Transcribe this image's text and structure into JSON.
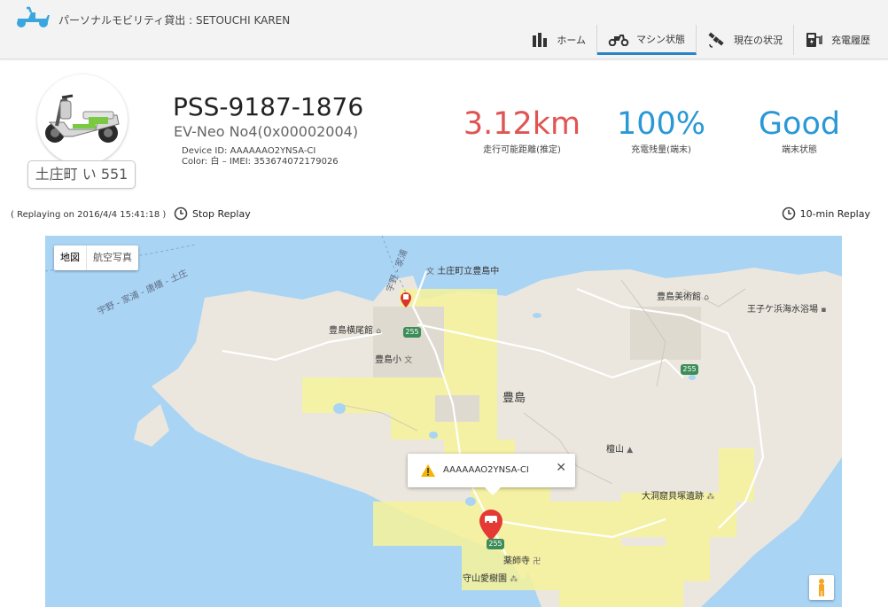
{
  "app": {
    "title": "パーソナルモビリティ貸出 : SETOUCHI KAREN"
  },
  "nav": {
    "items": [
      {
        "label": "ホーム",
        "icon": "bar-chart-icon",
        "active": false
      },
      {
        "label": "マシン状態",
        "icon": "scooter-icon",
        "active": true
      },
      {
        "label": "現在の状況",
        "icon": "satellite-icon",
        "active": false
      },
      {
        "label": "充電履歴",
        "icon": "charging-station-icon",
        "active": false
      }
    ]
  },
  "vehicle": {
    "plate": "土庄町 い 551",
    "id": "PSS-9187-1876",
    "model": "EV-Neo No4(0x00002004)",
    "device_id": "Device ID: AAAAAAO2YNSA-CI",
    "color_imei": "Color: 白 – IMEI: 353674072179026"
  },
  "metrics": {
    "range": {
      "value": "3.12km",
      "label": "走行可能距離(推定)"
    },
    "battery": {
      "value": "100%",
      "label": "充電残量(端末)"
    },
    "state": {
      "value": "Good",
      "label": "端末状態"
    }
  },
  "replay": {
    "info": "( Replaying on  2016/4/4 15:41:18 )",
    "stop_label": "Stop Replay",
    "tenmin_label": "10-min Replay"
  },
  "map": {
    "type_map": "地図",
    "type_aerial": "航空写真",
    "route_numbers": [
      "255",
      "255",
      "255"
    ],
    "road_label_1": "宇野 - 家浦 - 唐櫃 - 土庄",
    "road_label_2": "宇野 - 家浦",
    "labels": {
      "school_top": "土庄町立豊島中",
      "museum": "豊島美術館",
      "beach": "王子ケ浜海水浴場",
      "yokoo": "豊島横尾館",
      "elementary": "豊島小",
      "island": "豊島",
      "mountain": "檀山",
      "shell_mound": "大洞窟貝塚遺跡",
      "temple": "薬師寺",
      "park": "守山愛樹園"
    },
    "popup_text": "AAAAAAO2YNSA-CI",
    "colors": {
      "sea": "#aad4f4",
      "land": "#ebe7de",
      "coverage": "#f6f39a",
      "accent": "#2a83c6",
      "range_red": "#e05452",
      "value_blue": "#2a98d6"
    }
  }
}
